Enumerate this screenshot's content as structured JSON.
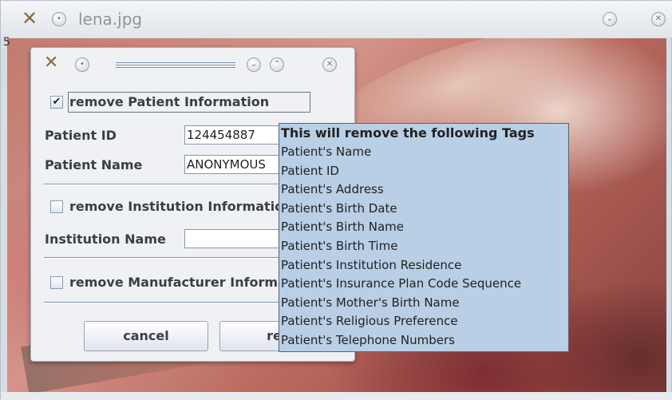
{
  "window": {
    "title": "lena.jpg",
    "corner_glyph": "5"
  },
  "icons": {
    "app": "app-x-icon",
    "pin": "pin-icon",
    "minimize": "chevron-down-icon",
    "maximize": "chevron-up-icon",
    "close": "close-icon"
  },
  "dialog": {
    "patient_section": {
      "checkbox_label": "remove Patient Information",
      "checked": true
    },
    "patient_id": {
      "label": "Patient ID",
      "value": "124454887"
    },
    "patient_name": {
      "label": "Patient Name",
      "value": "ANONYMOUS"
    },
    "institution_section": {
      "checkbox_label": "remove Institution Information",
      "checked": false
    },
    "institution_name": {
      "label": "Institution Name",
      "value": ""
    },
    "manufacturer_section": {
      "checkbox_label": "remove Manufacturer Information",
      "checked": false
    },
    "buttons": {
      "cancel": "cancel",
      "second": "remove"
    }
  },
  "tooltip": {
    "title": "This will remove the following Tags",
    "items": [
      "Patient's Name",
      "Patient ID",
      "Patient's Address",
      "Patient's Birth Date",
      "Patient's Birth Name",
      "Patient's Birth Time",
      "Patient's Institution Residence",
      "Patient's Insurance Plan Code Sequence",
      "Patient's Mother's Birth Name",
      "Patient's Religious Preference",
      "Patient's Telephone Numbers"
    ]
  },
  "colors": {
    "tooltip_background": "#b8cfe5",
    "dialog_background": "#eff1f4",
    "separator": "#7e93b3"
  }
}
